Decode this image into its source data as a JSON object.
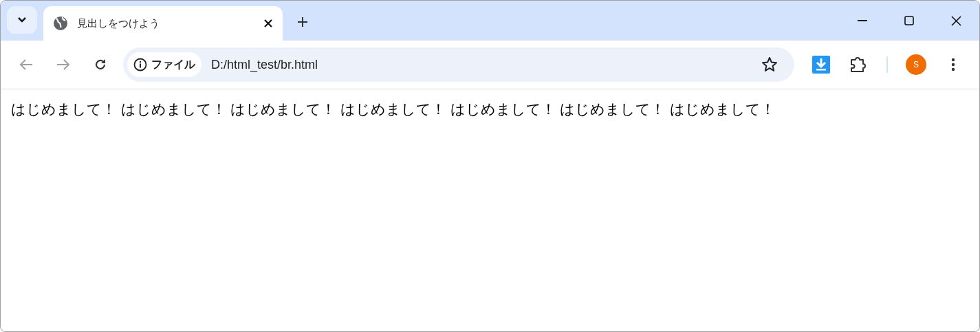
{
  "tabs": [
    {
      "title": "見出しをつけよう",
      "selected": true
    }
  ],
  "address_bar": {
    "chip": "ファイル",
    "url": "D:/html_test/br.html"
  },
  "profile": {
    "initial": "S"
  },
  "page": {
    "text": "はじめまして！ はじめまして！ はじめまして！ はじめまして！ はじめまして！ はじめまして！ はじめまして！"
  }
}
